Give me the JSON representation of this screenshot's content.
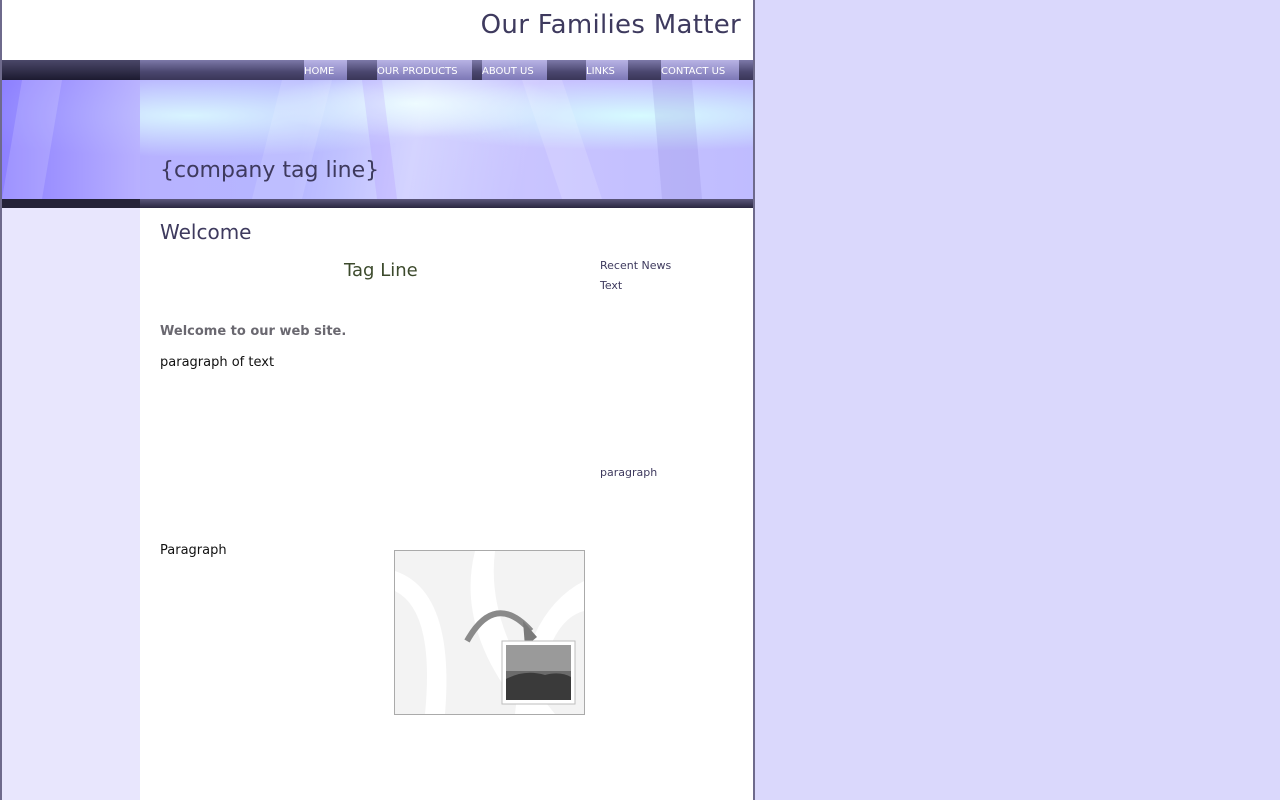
{
  "site": {
    "title": "Our Families Matter",
    "tagline": "{company tag line}"
  },
  "nav": {
    "items": [
      {
        "label": "HOME"
      },
      {
        "label": "OUR PRODUCTS"
      },
      {
        "label": "ABOUT US"
      },
      {
        "label": "LINKS"
      },
      {
        "label": "CONTACT US"
      }
    ]
  },
  "main": {
    "heading": "Welcome",
    "subheading": "Tag Line",
    "welcome": "Welcome to our web site.",
    "paragraph1": "paragraph of text",
    "paragraph2": "Paragraph"
  },
  "sidebar": {
    "heading": "Recent News",
    "text": "Text",
    "paragraph": "paragraph"
  },
  "colors": {
    "background": "#dad8fc",
    "accent": "#3e3a5e",
    "nav": "#4a466e"
  }
}
